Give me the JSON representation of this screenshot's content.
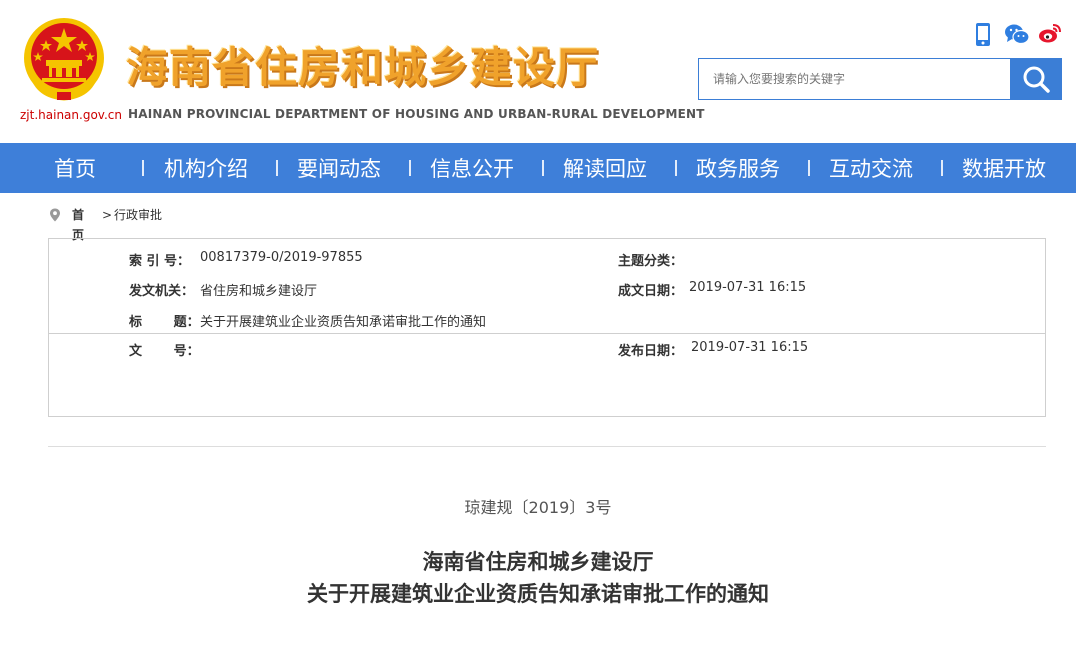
{
  "header": {
    "site_url": "zjt.hainan.gov.cn",
    "title_cn": "海南省住房和城乡建设厅",
    "title_en": "HAINAN PROVINCIAL DEPARTMENT OF HOUSING AND URBAN-RURAL DEVELOPMENT",
    "icons": [
      "mobile-icon",
      "wechat-icon",
      "weibo-icon"
    ],
    "search_placeholder": "请输入您要搜索的关键字"
  },
  "nav": {
    "items": [
      {
        "label": "首页"
      },
      {
        "label": "机构介绍"
      },
      {
        "label": "要闻动态"
      },
      {
        "label": "信息公开"
      },
      {
        "label": "解读回应"
      },
      {
        "label": "政务服务"
      },
      {
        "label": "互动交流"
      },
      {
        "label": "数据开放"
      }
    ]
  },
  "breadcrumb": {
    "home": "首页",
    "separator": ">",
    "current": "行政审批"
  },
  "meta": {
    "index_label": "索  引 号：",
    "index_value": "00817379-0/2019-97855",
    "subject_label": "主题分类：",
    "subject_value": "",
    "issuer_label": "发文机关：",
    "issuer_value": "省住房和城乡建设厅",
    "created_label": "成文日期：",
    "created_value": "2019-07-31 16:15",
    "title_label": "标       题：",
    "title_value": "关于开展建筑业企业资质告知承诺审批工作的通知",
    "docno_label": "文       号：",
    "docno_value": "",
    "published_label": "发布日期：",
    "published_value": "2019-07-31 16:15"
  },
  "document": {
    "number": "琼建规〔2019〕3号",
    "title_line1": "海南省住房和城乡建设厅",
    "title_line2": "关于开展建筑业企业资质告知承诺审批工作的通知"
  },
  "colors": {
    "nav_bg": "#3e7fd9",
    "title_orange": "#f0a22b",
    "emblem_red": "#d7141a",
    "emblem_gold": "#f5c400"
  }
}
